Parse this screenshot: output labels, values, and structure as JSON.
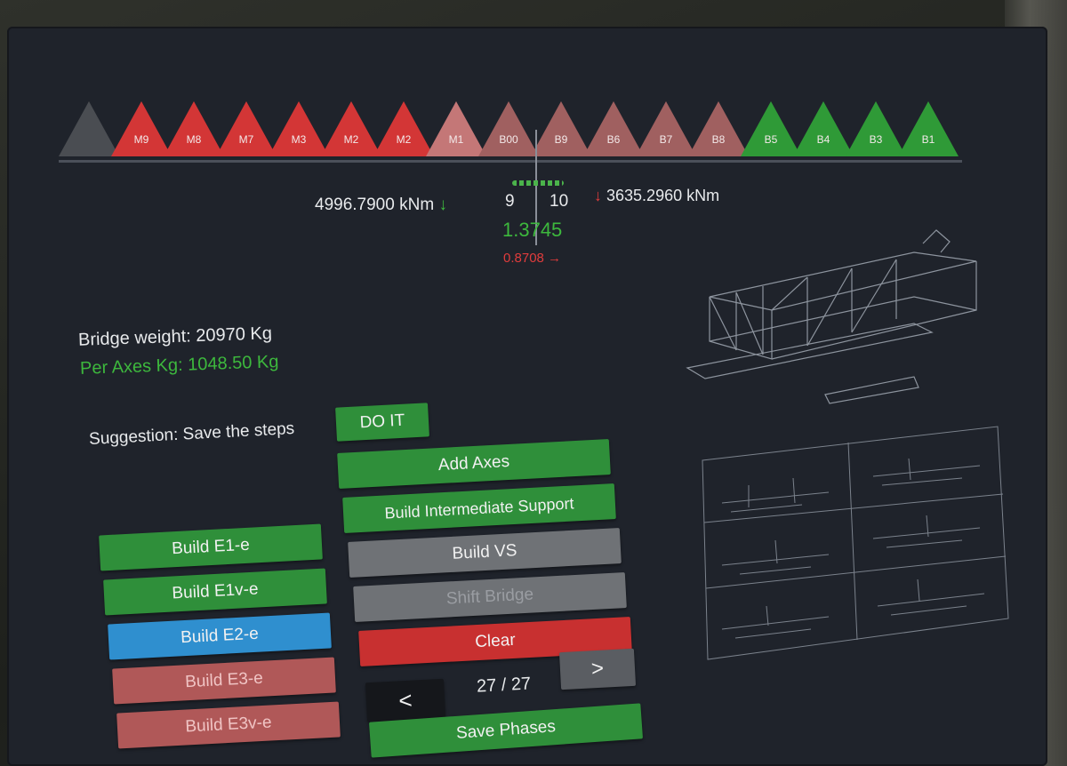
{
  "axes": [
    {
      "label": "",
      "color": "#4a4d52"
    },
    {
      "label": "M9",
      "color": "#d33636"
    },
    {
      "label": "M8",
      "color": "#d33636"
    },
    {
      "label": "M7",
      "color": "#d33636"
    },
    {
      "label": "M3",
      "color": "#d33636"
    },
    {
      "label": "M2",
      "color": "#d33636"
    },
    {
      "label": "M2",
      "color": "#d33636"
    },
    {
      "label": "M1",
      "color": "#c47777"
    },
    {
      "label": "B00",
      "color": "#a06060"
    },
    {
      "label": "B9",
      "color": "#a06060"
    },
    {
      "label": "B6",
      "color": "#a06060"
    },
    {
      "label": "B7",
      "color": "#a06060"
    },
    {
      "label": "B8",
      "color": "#a06060"
    },
    {
      "label": "B5",
      "color": "#2f9a37"
    },
    {
      "label": "B4",
      "color": "#2f9a37"
    },
    {
      "label": "B3",
      "color": "#2f9a37"
    },
    {
      "label": "B1",
      "color": "#2f9a37"
    }
  ],
  "readouts": {
    "left_moment": "4996.7900 kNm",
    "left_arrow": "↓",
    "left_index": "9",
    "right_index": "10",
    "right_arrow": "↓",
    "right_moment": "3635.2960 kNm",
    "ratio_main": "1.3745",
    "ratio_secondary": "0.8708 →"
  },
  "weights": {
    "bridge_weight": "Bridge weight: 20970 Kg",
    "per_axes": "Per Axes Kg: 1048.50 Kg"
  },
  "suggestion": {
    "text": "Suggestion: Save the steps",
    "do_it": "DO IT"
  },
  "left_buttons": [
    {
      "label": "Build E1-e",
      "style": "green"
    },
    {
      "label": "Build E1v-e",
      "style": "green"
    },
    {
      "label": "Build E2-e",
      "style": "blue"
    },
    {
      "label": "Build E3-e",
      "style": "pink"
    },
    {
      "label": "Build E3v-e",
      "style": "pink"
    }
  ],
  "center_buttons": {
    "add_axes": "Add Axes",
    "build_intermediate_support": "Build Intermediate Support",
    "build_vs": "Build VS",
    "shift_bridge": "Shift Bridge",
    "clear": "Clear",
    "save_phases": "Save Phases"
  },
  "pager": {
    "prev": "<",
    "status": "27 / 27",
    "next": ">"
  },
  "colors": {
    "accent_green": "#2f8f3a",
    "accent_red": "#c83030",
    "accent_blue": "#2f8fcf",
    "screen_bg": "#1f232b"
  }
}
